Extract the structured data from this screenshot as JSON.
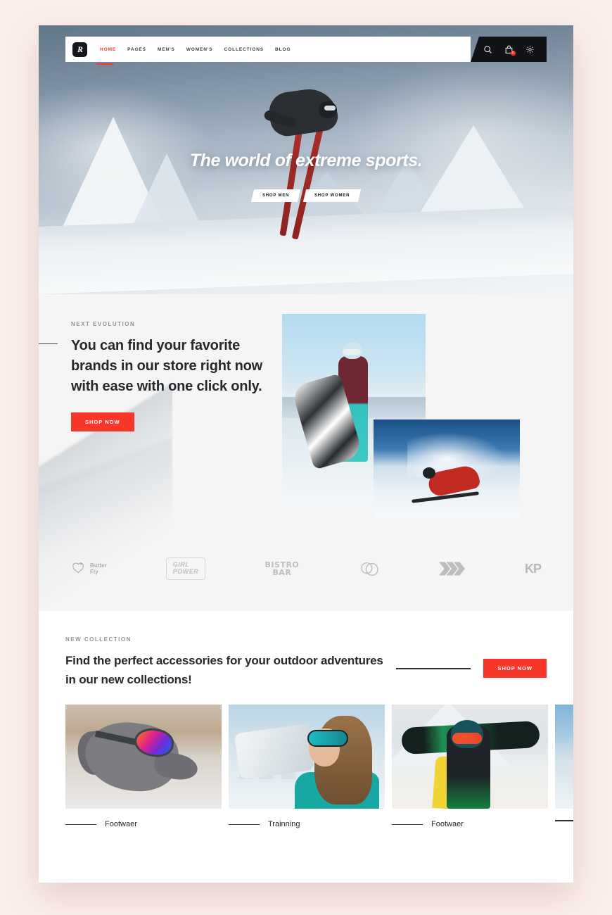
{
  "site": {
    "logo_letter": "R"
  },
  "nav": {
    "items": [
      {
        "label": "HOME",
        "active": true
      },
      {
        "label": "PAGES",
        "active": false
      },
      {
        "label": "MEN'S",
        "active": false
      },
      {
        "label": "WOMEN'S",
        "active": false
      },
      {
        "label": "COLLECTIONS",
        "active": false
      },
      {
        "label": "BLOG",
        "active": false
      }
    ],
    "icons": [
      {
        "name": "search-icon"
      },
      {
        "name": "shopping-bag-icon"
      },
      {
        "name": "settings-gear-icon"
      }
    ],
    "cart_count": "0"
  },
  "hero": {
    "title": "The world of extreme sports.",
    "buttons": [
      {
        "label": "SHOP MEN"
      },
      {
        "label": "SHOP WOMEN"
      }
    ]
  },
  "brands_section": {
    "eyebrow": "NEXT EVOLUTION",
    "heading": "You can find your favorite brands in our store right now with ease with one click only.",
    "cta_label": "SHOP NOW",
    "logos": [
      {
        "name": "butterfly-logo",
        "line1": "Butter",
        "line2": "Fly"
      },
      {
        "name": "girl-power-logo",
        "line1": "GIRL",
        "line2": "POWER"
      },
      {
        "name": "bistro-bar-logo",
        "line1": "BISTRO",
        "line2": "BAR"
      },
      {
        "name": "circles-logo",
        "label": ""
      },
      {
        "name": "chevrons-logo",
        "label": ""
      },
      {
        "name": "kp-logo",
        "label": "KP"
      }
    ]
  },
  "collection_section": {
    "eyebrow": "NEW COLLECTION",
    "heading": "Find the perfect accessories for your outdoor adventures in our new collections!",
    "cta_label": "SHOP NOW",
    "cards": [
      {
        "title": "Footwaer",
        "image": "dog-with-goggles"
      },
      {
        "title": "Trainning",
        "image": "woman-with-goggles"
      },
      {
        "title": "Footwaer",
        "image": "snowboarder-with-board"
      },
      {
        "title": "",
        "image": "snow-landscape-partial"
      }
    ]
  },
  "colors": {
    "accent_red": "#f8372b",
    "page_background": "#fbeeea",
    "dark": "#111316",
    "section_gray": "#f5f5f5"
  }
}
